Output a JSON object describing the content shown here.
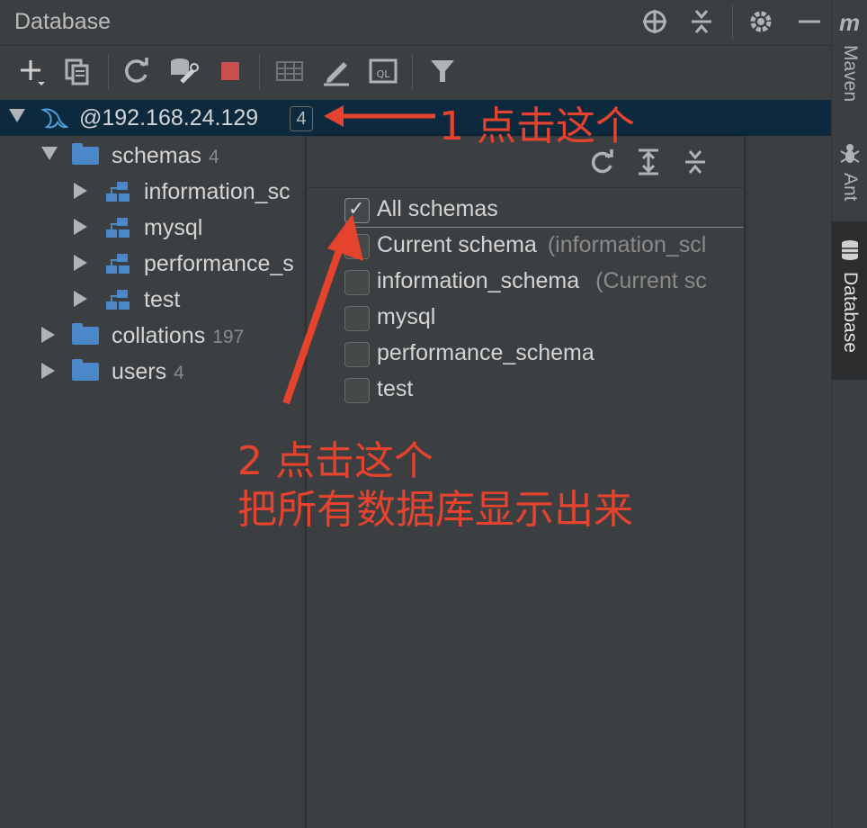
{
  "panel": {
    "title": "Database"
  },
  "tree": {
    "connection": {
      "label": "@192.168.24.129",
      "count": "4"
    },
    "schemas_folder": {
      "label": "schemas",
      "count": "4"
    },
    "schemas": [
      {
        "label": "information_sc"
      },
      {
        "label": "mysql"
      },
      {
        "label": "performance_s"
      },
      {
        "label": "test"
      }
    ],
    "collations": {
      "label": "collations",
      "count": "197"
    },
    "users": {
      "label": "users",
      "count": "4"
    }
  },
  "popup": {
    "options": [
      {
        "label": "All schemas",
        "sub": "",
        "checked": true
      },
      {
        "label": "Current schema",
        "sub": "(information_scl",
        "checked": false
      },
      {
        "label": "information_schema",
        "sub": "(Current sc",
        "checked": false
      },
      {
        "label": "mysql",
        "sub": "",
        "checked": false
      },
      {
        "label": "performance_schema",
        "sub": "",
        "checked": false
      },
      {
        "label": "test",
        "sub": "",
        "checked": false
      }
    ]
  },
  "side_strip": {
    "maven_logo": "m",
    "maven": "Maven",
    "ant": "Ant",
    "database": "Database"
  },
  "annotations": {
    "step1": "1 点击这个",
    "step2_line1": "2 点击这个",
    "step2_line2": "把所有数据库显示出来"
  },
  "colors": {
    "selection": "#0d293e",
    "annotation": "#e5432d",
    "folder": "#4a88c7",
    "stop": "#c94f4f"
  }
}
